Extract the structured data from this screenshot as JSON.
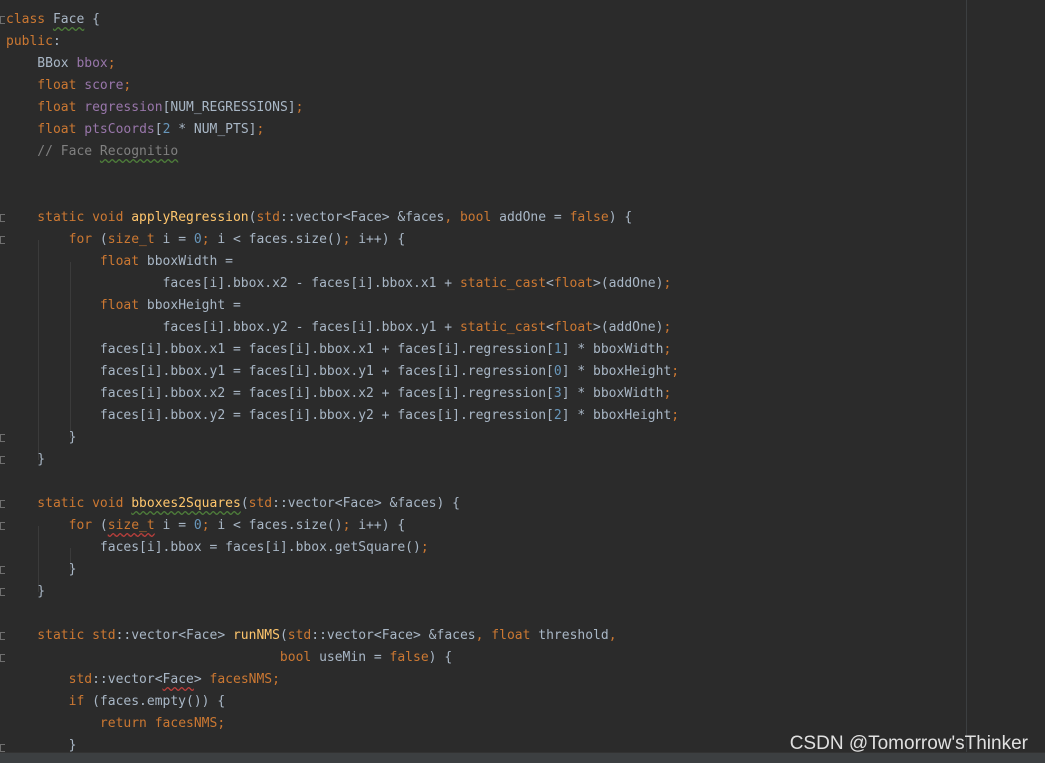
{
  "code": {
    "lines": [
      [
        {
          "t": "class ",
          "c": "kw"
        },
        {
          "t": "Face",
          "c": "wavy"
        },
        {
          "t": " {"
        }
      ],
      [
        {
          "t": "public",
          "c": "kw"
        },
        {
          "t": ":"
        }
      ],
      [
        {
          "t": "    BBox "
        },
        {
          "t": "bbox",
          "c": "fld"
        },
        {
          "t": ";",
          "c": "kw"
        }
      ],
      [
        {
          "t": "    float ",
          "c": "kw"
        },
        {
          "t": "score",
          "c": "fld"
        },
        {
          "t": ";",
          "c": "kw"
        }
      ],
      [
        {
          "t": "    float ",
          "c": "kw"
        },
        {
          "t": "regression",
          "c": "fld"
        },
        {
          "t": "[NUM_REGRESSIONS]"
        },
        {
          "t": ";",
          "c": "kw"
        }
      ],
      [
        {
          "t": "    float ",
          "c": "kw"
        },
        {
          "t": "ptsCoords",
          "c": "fld"
        },
        {
          "t": "["
        },
        {
          "t": "2",
          "c": "num"
        },
        {
          "t": " * NUM_PTS]"
        },
        {
          "t": ";",
          "c": "kw"
        }
      ],
      [
        {
          "t": "    // Face ",
          "c": "cm"
        },
        {
          "t": "Recognitio",
          "c": "cm wavy"
        }
      ],
      [],
      [],
      [
        {
          "t": "    static void ",
          "c": "kw"
        },
        {
          "t": "applyRegression",
          "c": "fn"
        },
        {
          "t": "("
        },
        {
          "t": "std",
          "c": "kw"
        },
        {
          "t": "::vector<Face> &faces"
        },
        {
          "t": ", ",
          "c": "kw"
        },
        {
          "t": "bool ",
          "c": "kw"
        },
        {
          "t": "addOne = "
        },
        {
          "t": "false",
          "c": "kw"
        },
        {
          "t": ") {"
        }
      ],
      [
        {
          "t": "        for ",
          "c": "kw"
        },
        {
          "t": "("
        },
        {
          "t": "size_t",
          "c": "kw"
        },
        {
          "t": " i = "
        },
        {
          "t": "0",
          "c": "num"
        },
        {
          "t": "; ",
          "c": "kw"
        },
        {
          "t": "i < faces.size()"
        },
        {
          "t": "; ",
          "c": "kw"
        },
        {
          "t": "i++) {"
        }
      ],
      [
        {
          "t": "            float ",
          "c": "kw"
        },
        {
          "t": "bboxWidth ="
        }
      ],
      [
        {
          "t": "                    faces[i].bbox.x2 - faces[i].bbox.x1 + "
        },
        {
          "t": "static_cast",
          "c": "kw"
        },
        {
          "t": "<"
        },
        {
          "t": "float",
          "c": "kw"
        },
        {
          "t": ">(addOne)"
        },
        {
          "t": ";",
          "c": "kw"
        }
      ],
      [
        {
          "t": "            float ",
          "c": "kw"
        },
        {
          "t": "bboxHeight ="
        }
      ],
      [
        {
          "t": "                    faces[i].bbox.y2 - faces[i].bbox.y1 + "
        },
        {
          "t": "static_cast",
          "c": "kw"
        },
        {
          "t": "<"
        },
        {
          "t": "float",
          "c": "kw"
        },
        {
          "t": ">(addOne)"
        },
        {
          "t": ";",
          "c": "kw"
        }
      ],
      [
        {
          "t": "            faces[i].bbox.x1 = faces[i].bbox.x1 + faces[i].regression["
        },
        {
          "t": "1",
          "c": "num"
        },
        {
          "t": "] * bboxWidth"
        },
        {
          "t": ";",
          "c": "kw"
        }
      ],
      [
        {
          "t": "            faces[i].bbox.y1 = faces[i].bbox.y1 + faces[i].regression["
        },
        {
          "t": "0",
          "c": "num"
        },
        {
          "t": "] * bboxHeight"
        },
        {
          "t": ";",
          "c": "kw"
        }
      ],
      [
        {
          "t": "            faces[i].bbox.x2 = faces[i].bbox.x2 + faces[i].regression["
        },
        {
          "t": "3",
          "c": "num"
        },
        {
          "t": "] * bboxWidth"
        },
        {
          "t": ";",
          "c": "kw"
        }
      ],
      [
        {
          "t": "            faces[i].bbox.y2 = faces[i].bbox.y2 + faces[i].regression["
        },
        {
          "t": "2",
          "c": "num"
        },
        {
          "t": "] * bboxHeight"
        },
        {
          "t": ";",
          "c": "kw"
        }
      ],
      [
        {
          "t": "        }"
        }
      ],
      [
        {
          "t": "    }"
        }
      ],
      [],
      [
        {
          "t": "    static void ",
          "c": "kw"
        },
        {
          "t": "bboxes2Squares",
          "c": "fn wavy"
        },
        {
          "t": "("
        },
        {
          "t": "std",
          "c": "kw"
        },
        {
          "t": "::vector<Face> &faces) {"
        }
      ],
      [
        {
          "t": "        for ",
          "c": "kw"
        },
        {
          "t": "("
        },
        {
          "t": "size_t",
          "c": "kw wavy-red"
        },
        {
          "t": " i = "
        },
        {
          "t": "0",
          "c": "num"
        },
        {
          "t": "; ",
          "c": "kw"
        },
        {
          "t": "i < faces.size()"
        },
        {
          "t": "; ",
          "c": "kw"
        },
        {
          "t": "i++) {"
        }
      ],
      [
        {
          "t": "            faces[i].bbox = faces[i].bbox.getSquare()"
        },
        {
          "t": ";",
          "c": "kw"
        }
      ],
      [
        {
          "t": "        }"
        }
      ],
      [
        {
          "t": "    }"
        }
      ],
      [],
      [
        {
          "t": "    static ",
          "c": "kw"
        },
        {
          "t": "std",
          "c": "kw"
        },
        {
          "t": "::vector<Face> "
        },
        {
          "t": "runNMS",
          "c": "fn"
        },
        {
          "t": "("
        },
        {
          "t": "std",
          "c": "kw"
        },
        {
          "t": "::vector<Face> &faces"
        },
        {
          "t": ", ",
          "c": "kw"
        },
        {
          "t": "float ",
          "c": "kw"
        },
        {
          "t": "threshold"
        },
        {
          "t": ",",
          "c": "kw"
        }
      ],
      [
        {
          "t": "                                   bool ",
          "c": "kw"
        },
        {
          "t": "useMin = "
        },
        {
          "t": "false",
          "c": "kw"
        },
        {
          "t": ") {"
        }
      ],
      [
        {
          "t": "        std",
          "c": "kw"
        },
        {
          "t": "::vector<"
        },
        {
          "t": "Face",
          "c": "wavy-red"
        },
        {
          "t": "> "
        },
        {
          "t": "facesNMS",
          "c": "kw"
        },
        {
          "t": ";",
          "c": "kw"
        }
      ],
      [
        {
          "t": "        if ",
          "c": "kw"
        },
        {
          "t": "(faces.empty()) {"
        }
      ],
      [
        {
          "t": "            return ",
          "c": "kw"
        },
        {
          "t": "facesNMS",
          "c": "kw"
        },
        {
          "t": ";",
          "c": "kw"
        }
      ],
      [
        {
          "t": "        }"
        }
      ]
    ]
  },
  "watermark": "CSDN @Tomorrow'sThinker"
}
